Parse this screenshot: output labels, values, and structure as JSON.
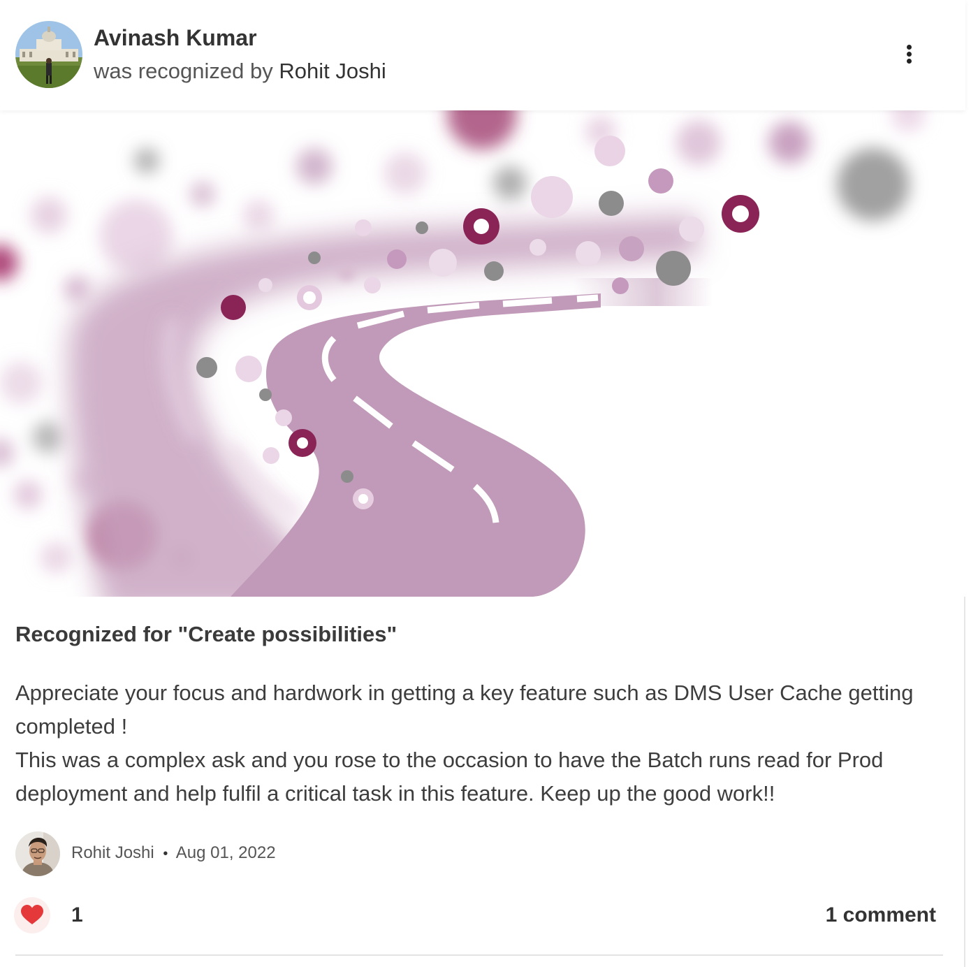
{
  "post": {
    "recipient_name": "Avinash Kumar",
    "recognized_by_prefix": "was recognized by",
    "recognizer_name": "Rohit Joshi",
    "award_title": "Recognized for \"Create possibilities\"",
    "message_lines": [
      "Appreciate your focus and hardwork in getting a key feature such as DMS User Cache getting completed !",
      "This was a complex ask and you rose to the occasion to have the Batch runs read for Prod deployment and help fulfil a critical task in this feature. Keep up the good work!!"
    ],
    "giver_name": "Rohit Joshi",
    "separator": "•",
    "date": "Aug 01, 2022"
  },
  "reactions": {
    "like_count": "1",
    "comment_label": "1 comment"
  },
  "icons": {
    "more": "more-vertical-icon",
    "like": "heart-icon"
  },
  "colors": {
    "road": "#c09ab8",
    "accent_dark": "#8e2a5e",
    "heart": "#e5383b",
    "dot_grey": "#8c8c8c"
  }
}
